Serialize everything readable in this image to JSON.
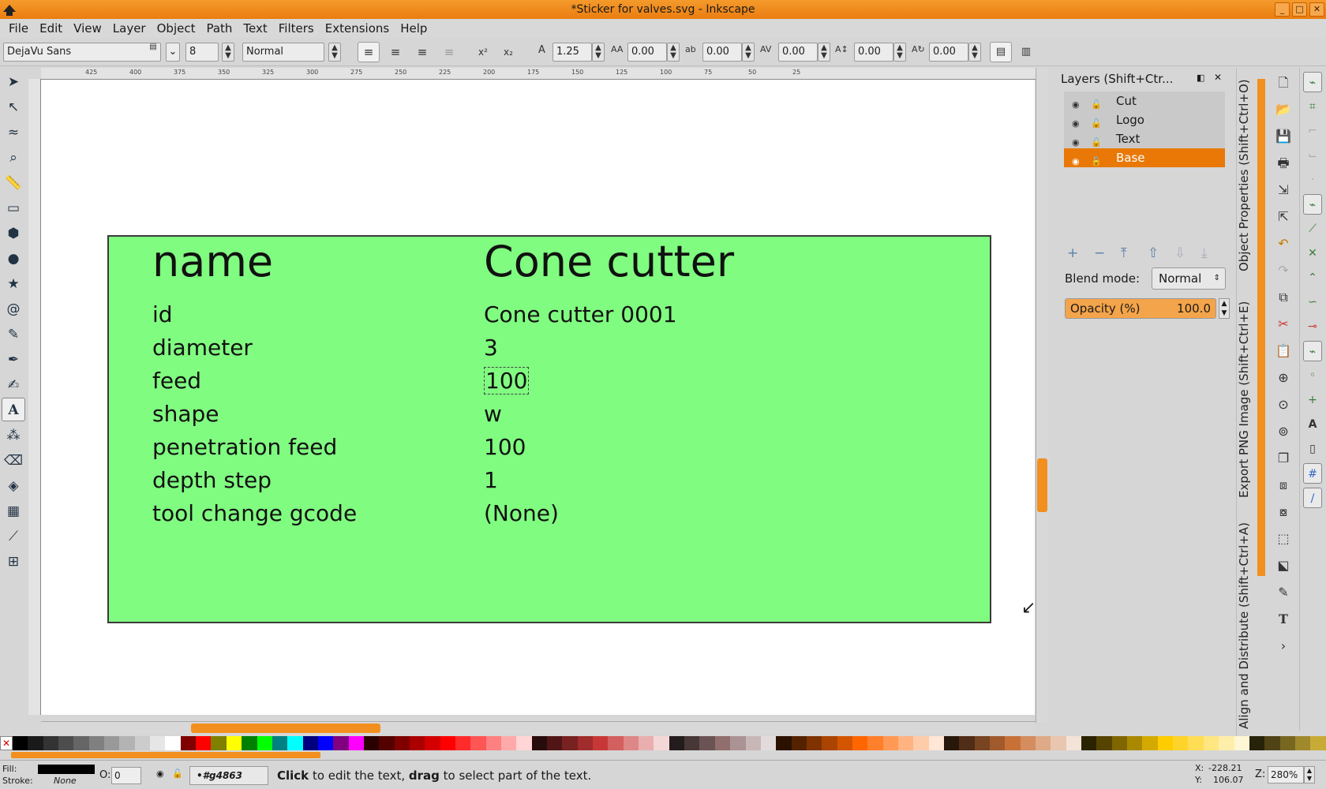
{
  "window": {
    "title": "*Sticker for valves.svg - Inkscape",
    "minimize": "_",
    "maximize": "□",
    "close": "✕"
  },
  "menu": [
    "File",
    "Edit",
    "View",
    "Layer",
    "Object",
    "Path",
    "Text",
    "Filters",
    "Extensions",
    "Help"
  ],
  "text_toolbar": {
    "font_family": "DejaVu Sans",
    "font_size": "8",
    "font_style": "Normal",
    "line_spacing": "1.25",
    "letter_spacing": "0.00",
    "word_spacing": "0.00",
    "kerning": "0.00",
    "vertical_shift": "0.00",
    "rotation": "0.00"
  },
  "ruler_labels": [
    "425",
    "400",
    "375",
    "350",
    "325",
    "300",
    "275",
    "250",
    "225",
    "200",
    "175",
    "150",
    "125",
    "100",
    "75",
    "50",
    "25"
  ],
  "sticker": {
    "header": {
      "key": "name",
      "value": "Cone cutter"
    },
    "rows": [
      {
        "key": "id",
        "value": "Cone cutter 0001"
      },
      {
        "key": "diameter",
        "value": "3"
      },
      {
        "key": "feed",
        "value": "100"
      },
      {
        "key": "shape",
        "value": "w"
      },
      {
        "key": "penetration feed",
        "value": "100"
      },
      {
        "key": "depth step",
        "value": "1"
      },
      {
        "key": "tool change gcode",
        "value": "(None)"
      }
    ]
  },
  "layers_panel": {
    "title": "Layers (Shift+Ctr...",
    "layers": [
      {
        "name": "Cut",
        "selected": false
      },
      {
        "name": "Logo",
        "selected": false
      },
      {
        "name": "Text",
        "selected": false
      },
      {
        "name": "Base",
        "selected": true
      }
    ],
    "blend_label": "Blend mode:",
    "blend_value": "Normal",
    "opacity_label": "Opacity (%)",
    "opacity_value": "100.0"
  },
  "vertical_tabs": {
    "object_properties": "Object Properties (Shift+Ctrl+O)",
    "export_png": "Export PNG Image (Shift+Ctrl+E)",
    "align_distribute": "Align and Distribute (Shift+Ctrl+A)"
  },
  "statusbar": {
    "fill_label": "Fill:",
    "stroke_label": "Stroke:",
    "stroke_value": "None",
    "opacity_label": "O:",
    "opacity_value": "0",
    "object_id": "•#g4863",
    "message_bold1": "Click",
    "message_mid": " to edit the text, ",
    "message_bold2": "drag",
    "message_end": " to select part of the text.",
    "x_label": "X:",
    "x_value": "-228.21",
    "y_label": "Y:",
    "y_value": "106.07",
    "zoom_label": "Z:",
    "zoom_value": "280%"
  },
  "colors": {
    "accent": "#f28f1e",
    "sticker_fill": "#80fc80",
    "selected_layer": "#e97807"
  },
  "palette": [
    "#000000",
    "#1a1a1a",
    "#333333",
    "#4d4d4d",
    "#666666",
    "#808080",
    "#999999",
    "#b3b3b3",
    "#cccccc",
    "#e6e6e6",
    "#ffffff",
    "#800000",
    "#ff0000",
    "#808000",
    "#ffff00",
    "#008000",
    "#00ff00",
    "#008080",
    "#00ffff",
    "#000080",
    "#0000ff",
    "#800080",
    "#ff00ff",
    "#2b0000",
    "#550000",
    "#800000",
    "#aa0000",
    "#d40000",
    "#ff0000",
    "#ff2a2a",
    "#ff5555",
    "#ff8080",
    "#ffaaaa",
    "#ffd5d5",
    "#280b0b",
    "#501616",
    "#782121",
    "#a02c2c",
    "#c83737",
    "#d35f5f",
    "#de8787",
    "#e9afaf",
    "#f4d7d7",
    "#241c1c",
    "#483737",
    "#6c5353",
    "#916f6f",
    "#ac9393",
    "#c8b7b7",
    "#e3dbdb",
    "#2b1100",
    "#552200",
    "#803300",
    "#aa4400",
    "#d45500",
    "#ff6600",
    "#ff7f2a",
    "#ff9955",
    "#ffb380",
    "#ffccaa",
    "#ffe6d5",
    "#28170b",
    "#502d16",
    "#784421",
    "#a05a2c",
    "#c87137",
    "#d38d5f",
    "#deaa87",
    "#e9c6af",
    "#f4e3d7",
    "#2b2200",
    "#554400",
    "#806600",
    "#aa8800",
    "#d4aa00",
    "#ffcc00",
    "#ffd42a",
    "#ffdd55",
    "#ffe680",
    "#ffeeaa",
    "#fff6d5",
    "#28220b",
    "#504416",
    "#786721",
    "#a0892c",
    "#c8ab37"
  ],
  "icons": {
    "toolbox": [
      "selector-icon",
      "node-icon",
      "tweak-icon",
      "zoom-icon",
      "measure-icon",
      "rect-icon",
      "box3d-icon",
      "ellipse-icon",
      "star-icon",
      "spiral-icon",
      "pencil-icon",
      "pen-icon",
      "calligraphy-icon",
      "text-icon",
      "spray-icon",
      "eraser-icon",
      "bucket-icon",
      "gradient-icon",
      "dropper-icon",
      "connector-icon"
    ]
  }
}
